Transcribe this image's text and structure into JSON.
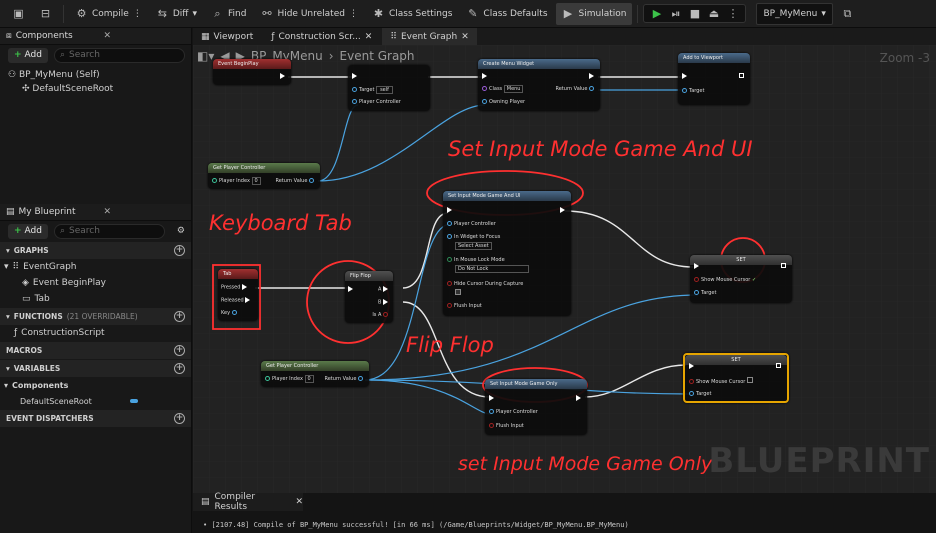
{
  "toolbar": {
    "compile": "Compile",
    "diff": "Diff",
    "find": "Find",
    "hide_unrelated": "Hide Unrelated",
    "class_settings": "Class Settings",
    "class_defaults": "Class Defaults",
    "simulation": "Simulation",
    "debug_object": "BP_MyMenu"
  },
  "components_panel": {
    "title": "Components",
    "add": "Add",
    "search_placeholder": "Search",
    "root": "BP_MyMenu (Self)",
    "child": "DefaultSceneRoot"
  },
  "blueprint_panel": {
    "title": "My Blueprint",
    "add": "Add",
    "search_placeholder": "Search",
    "graphs_header": "GRAPHS",
    "event_graph": "EventGraph",
    "event_begin_play": "Event BeginPlay",
    "tab": "Tab",
    "functions_header": "FUNCTIONS",
    "functions_count": "(21 OVERRIDABLE)",
    "construction_script": "ConstructionScript",
    "macros_header": "MACROS",
    "variables_header": "VARIABLES",
    "components_group": "Components",
    "default_scene_root": "DefaultSceneRoot",
    "event_dispatchers_header": "EVENT DISPATCHERS"
  },
  "graph_tabs": [
    "Viewport",
    "Construction Scr...",
    "Event Graph"
  ],
  "breadcrumb": {
    "asset": "BP_MyMenu",
    "graph": "Event Graph",
    "zoom": "Zoom -3"
  },
  "nodes": {
    "event_begin_play": "Event BeginPlay",
    "create_widget": "Create Menu Widget",
    "class_label": "Class",
    "class_value": "Menu",
    "return_value": "Return Value",
    "owning_player": "Owning Player",
    "add_to_viewport": "Add to Viewport",
    "target": "Target",
    "target_self": "self",
    "player_controller": "Player Controller",
    "get_player_controller": "Get Player Controller",
    "player_index": "Player Index",
    "player_index_value": "0",
    "set_game_and_ui": "Set Input Mode Game And UI",
    "in_widget_to_focus": "In Widget to Focus",
    "select_asset": "Select Asset",
    "in_mouse_lock_mode": "In Mouse Lock Mode",
    "do_not_lock": "Do Not Lock",
    "hide_cursor": "Hide Cursor During Capture",
    "flush_input": "Flush Input",
    "tab_node": "Tab",
    "pressed": "Pressed",
    "released": "Released",
    "key": "Key",
    "flip_flop": "Flip Flop",
    "a": "A",
    "b": "B",
    "is_a": "Is A",
    "set": "SET",
    "show_mouse_cursor": "Show Mouse Cursor",
    "set_game_only": "Set Input Mode Game Only"
  },
  "annotations": {
    "game_and_ui": "Set Input Mode Game And UI",
    "keyboard_tab": "Keyboard Tab",
    "flip_flop": "Flip Flop",
    "game_only": "set Input Mode Game Only"
  },
  "watermark": "BLUEPRINT",
  "compiler": {
    "tab": "Compiler Results",
    "log": "[2107.48] Compile of BP_MyMenu successful! [in 66 ms] (/Game/Blueprints/Widget/BP_MyMenu.BP_MyMenu)"
  },
  "colors": {
    "annotation": "#ff3030",
    "exec_wire": "#e8e8e8",
    "object_wire": "#4aa3e0",
    "selected_node": "#e6a500"
  }
}
